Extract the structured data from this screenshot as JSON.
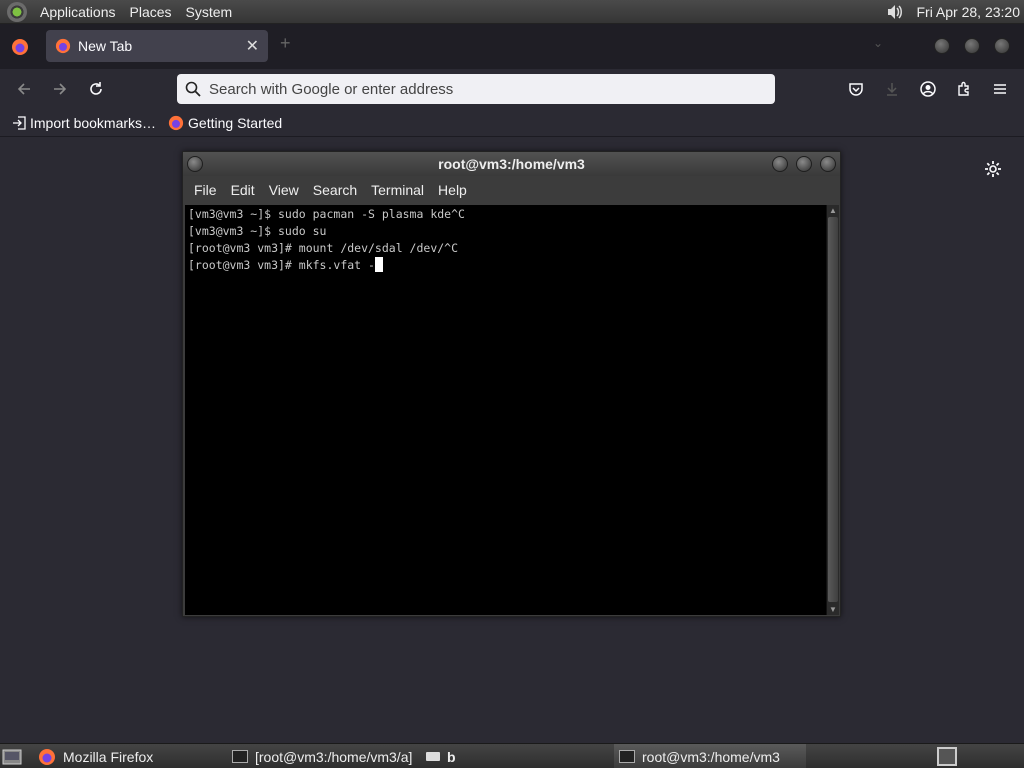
{
  "top_panel": {
    "menus": [
      "Applications",
      "Places",
      "System"
    ],
    "clock": "Fri Apr 28, 23:20"
  },
  "browser": {
    "tab_title": "New Tab",
    "url_placeholder": "Search with Google or enter address",
    "bookmarks": [
      "Import bookmarks…",
      "Getting Started"
    ]
  },
  "terminal": {
    "title": "root@vm3:/home/vm3",
    "menus": [
      "File",
      "Edit",
      "View",
      "Search",
      "Terminal",
      "Help"
    ],
    "lines": [
      "[vm3@vm3 ~]$ sudo pacman -S plasma kde^C",
      "[vm3@vm3 ~]$ sudo su",
      "[root@vm3 vm3]# mount /dev/sdal /dev/^C",
      "[root@vm3 vm3]# mkfs.vfat -"
    ]
  },
  "taskbar": {
    "items": [
      "Mozilla Firefox",
      "[root@vm3:/home/vm3/a]",
      "b",
      "root@vm3:/home/vm3"
    ]
  },
  "colors": {
    "browser_bg": "#2b2a33",
    "terminal_bg": "#000000",
    "panel_bg": "#3a3a3a"
  }
}
